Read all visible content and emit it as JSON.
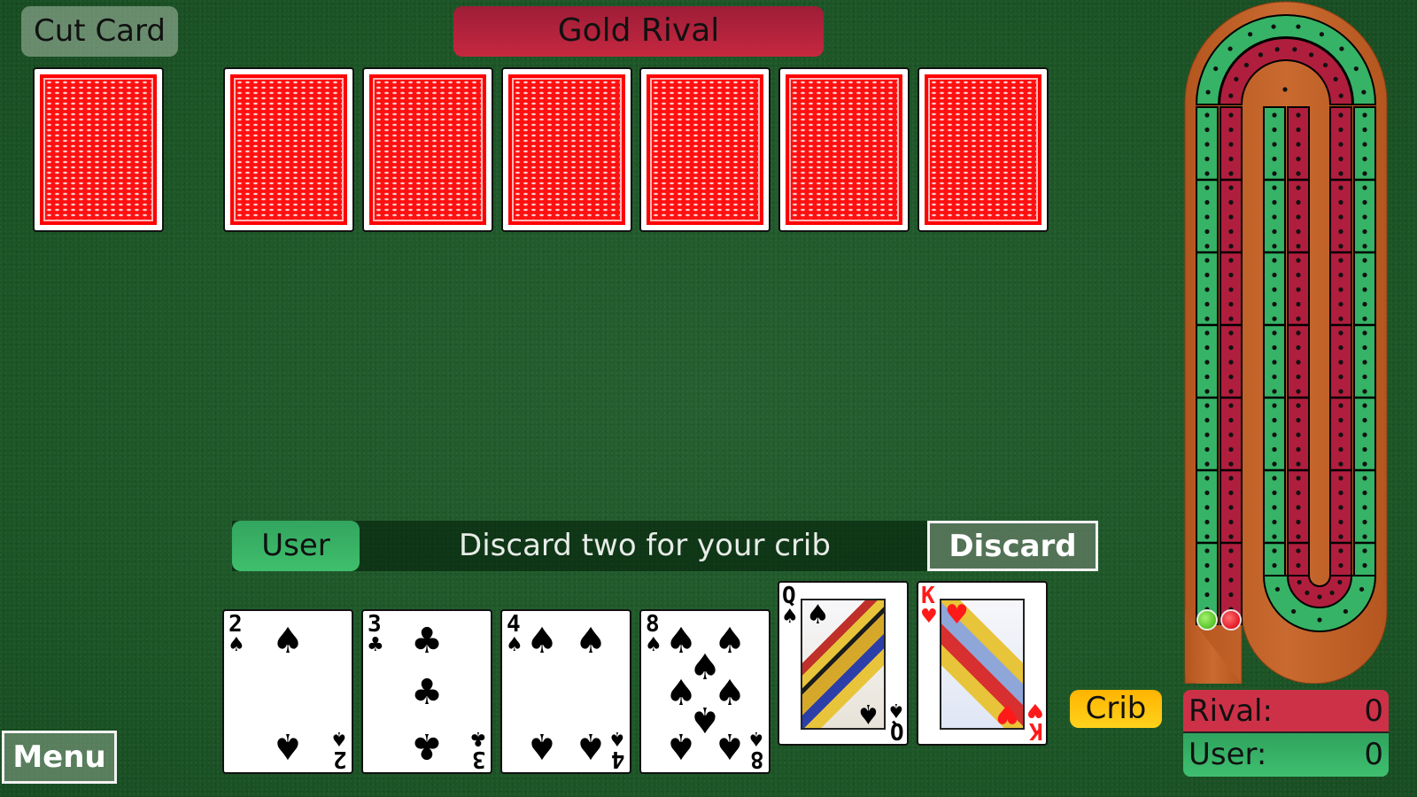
{
  "header": {
    "cut_card_label": "Cut Card",
    "opponent_name": "Gold Rival"
  },
  "cut_card": {
    "face": "down"
  },
  "rival_hand": {
    "cards": [
      {
        "face": "down"
      },
      {
        "face": "down"
      },
      {
        "face": "down"
      },
      {
        "face": "down"
      },
      {
        "face": "down"
      },
      {
        "face": "down"
      }
    ]
  },
  "status": {
    "player_label": "User",
    "message": "Discard two for your crib",
    "discard_button": "Discard"
  },
  "user_hand": {
    "cards": [
      {
        "rank": "2",
        "suit": "spades",
        "suit_glyph": "♠",
        "color": "black",
        "selected": false
      },
      {
        "rank": "3",
        "suit": "clubs",
        "suit_glyph": "♣",
        "color": "black",
        "selected": false
      },
      {
        "rank": "4",
        "suit": "spades",
        "suit_glyph": "♠",
        "color": "black",
        "selected": false
      },
      {
        "rank": "8",
        "suit": "spades",
        "suit_glyph": "♠",
        "color": "black",
        "selected": false
      },
      {
        "rank": "Q",
        "suit": "spades",
        "suit_glyph": "♠",
        "color": "black",
        "selected": true
      },
      {
        "rank": "K",
        "suit": "hearts",
        "suit_glyph": "♥",
        "color": "red",
        "selected": true
      }
    ]
  },
  "crib": {
    "label": "Crib",
    "owner": "User"
  },
  "scores": {
    "rival": {
      "label": "Rival:",
      "value": "0"
    },
    "user": {
      "label": "User:",
      "value": "0"
    }
  },
  "board": {
    "rival_peg_score": 0,
    "user_peg_score": 0,
    "colors": {
      "wood": "#c0622a",
      "user_track": "#36b366",
      "rival_track": "#b01e3e",
      "user_peg": "#5fd02c",
      "rival_peg": "#e8182a"
    }
  },
  "menu": {
    "label": "Menu"
  },
  "colors": {
    "felt": "#1f5a2a",
    "card_back": "#ff1010",
    "rival_banner": "#b5223b",
    "user_tag": "#3ab366",
    "crib_tag": "#ffc40a",
    "score_rival": "#cd3148",
    "score_user": "#36b366"
  }
}
